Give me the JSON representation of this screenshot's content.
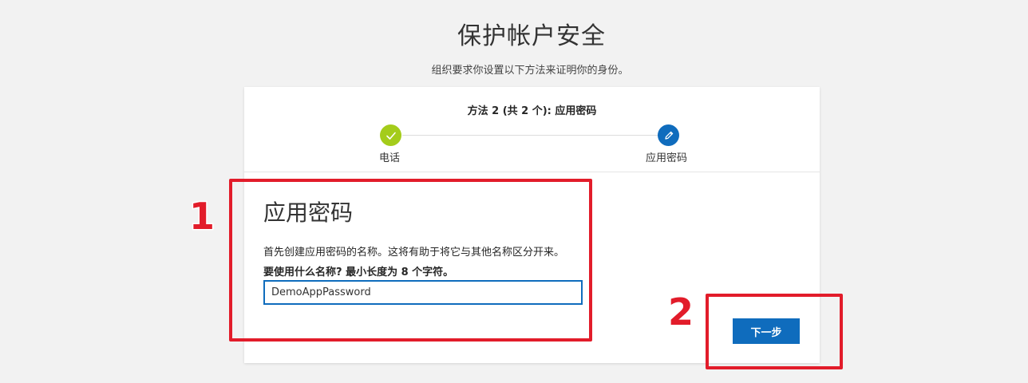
{
  "page": {
    "title": "保护帐户安全",
    "subtitle": "组织要求你设置以下方法来证明你的身份。"
  },
  "progress": {
    "caption": "方法 2 (共 2 个): 应用密码",
    "steps": [
      {
        "label": "电话",
        "status": "completed",
        "icon": "checkmark-icon"
      },
      {
        "label": "应用密码",
        "status": "current",
        "icon": "pencil-icon"
      }
    ]
  },
  "form": {
    "section_title": "应用密码",
    "instruction": "首先创建应用密码的名称。这将有助于将它与其他名称区分开来。",
    "question": "要使用什么名称? 最小长度为 8 个字符。",
    "name_value": "DemoAppPassword",
    "next_label": "下一步"
  },
  "annotations": [
    {
      "number": "1"
    },
    {
      "number": "2"
    }
  ],
  "colors": {
    "accent": "#0f6cbd",
    "completed": "#a4cc1b",
    "annotation": "#e21c2a"
  }
}
